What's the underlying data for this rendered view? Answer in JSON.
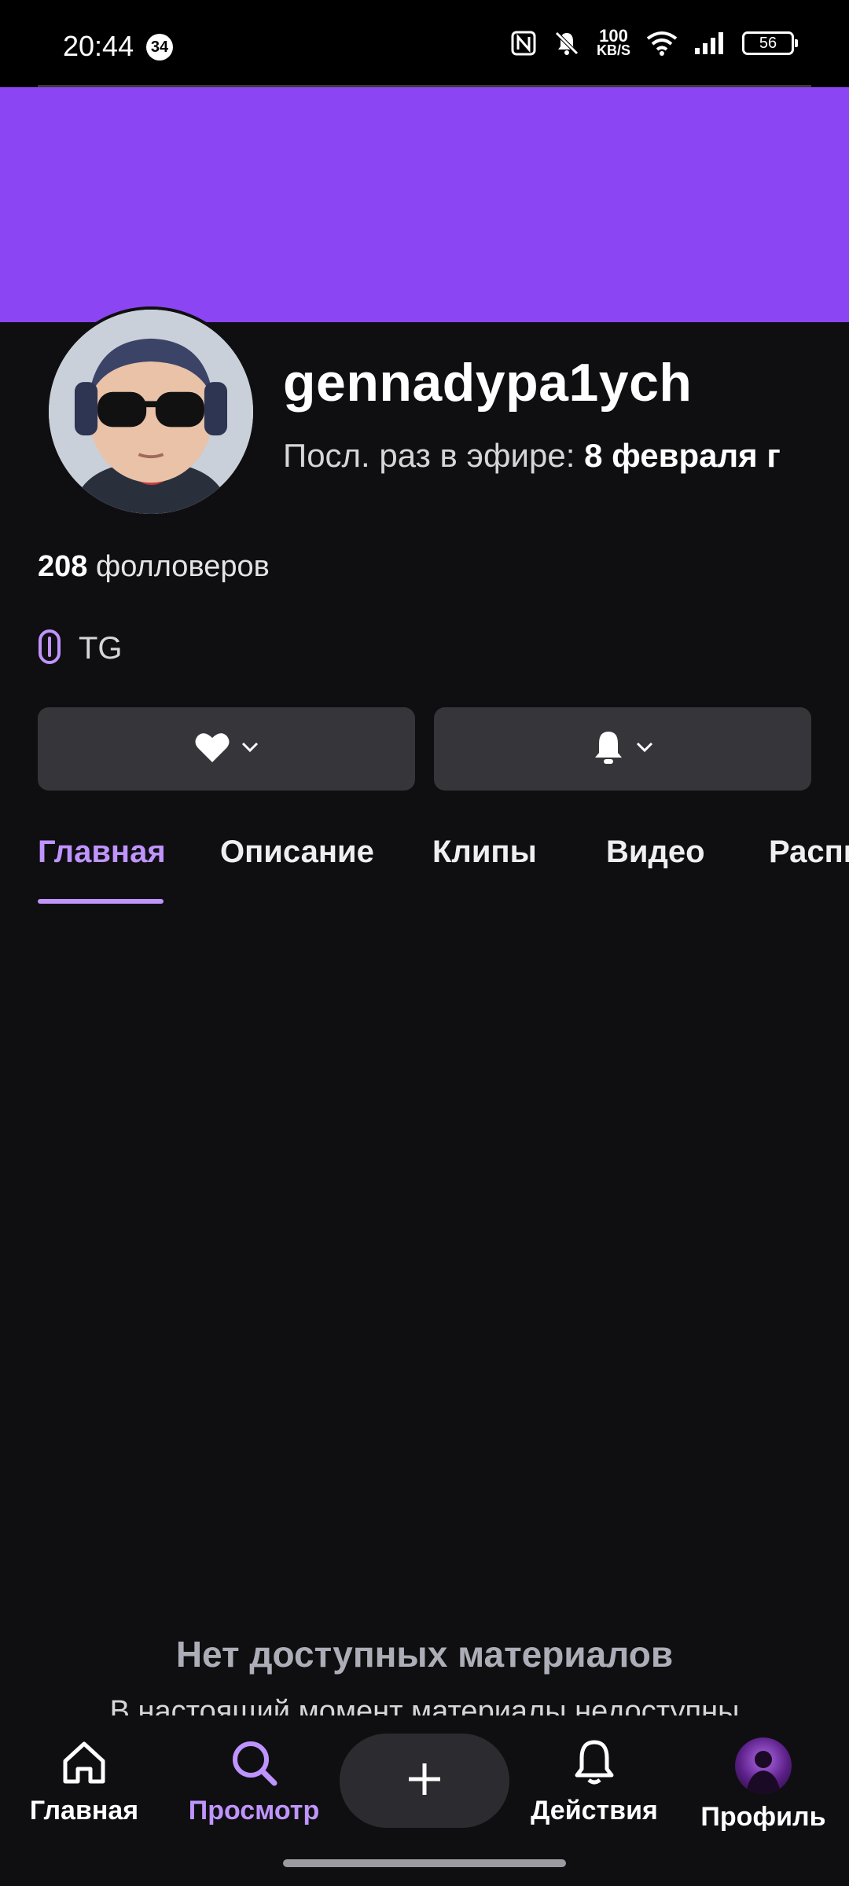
{
  "status_bar": {
    "time": "20:44",
    "notification_count": "34",
    "net_speed_value": "100",
    "net_speed_unit": "KB/S",
    "battery": "56"
  },
  "channel": {
    "username": "gennadypa1ych",
    "last_live_label": "Посл. раз в эфире:",
    "last_live_value": "8 февраля  г",
    "followers_count": "208",
    "followers_label": "фолловеров",
    "link_label": "TG",
    "accent_color": "#8c45f2"
  },
  "actions": {
    "follow_icon": "heart-icon",
    "notify_icon": "bell-icon"
  },
  "tabs": [
    {
      "label": "Главная",
      "active": true
    },
    {
      "label": "Описание"
    },
    {
      "label": "Клипы"
    },
    {
      "label": "Видео"
    },
    {
      "label": "Расписание"
    }
  ],
  "empty_state": {
    "title": "Нет доступных материалов",
    "subtitle": "В настоящий момент материалы недоступны"
  },
  "bottom_nav": {
    "home": "Главная",
    "browse": "Просмотр",
    "activity": "Действия",
    "profile": "Профиль",
    "active_color": "#bf94ff"
  }
}
